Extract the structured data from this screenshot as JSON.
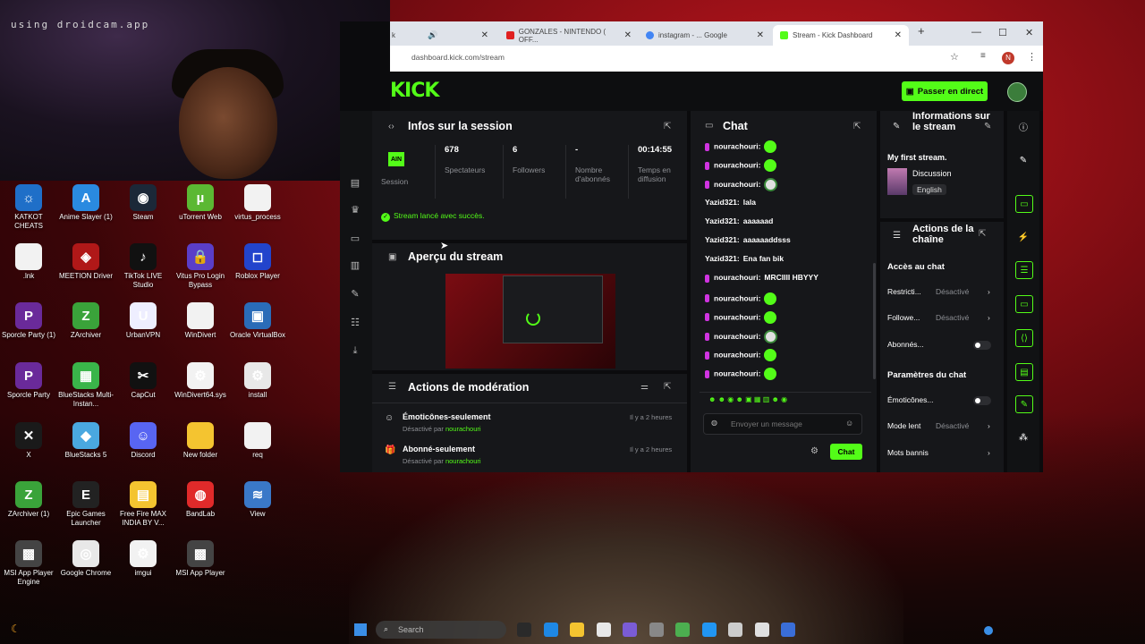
{
  "webcam": {
    "overlay_text": "using droidcam.app"
  },
  "desktop_icons": [
    {
      "label": "KATKOT CHEATS",
      "color": "#1f6fc8",
      "glyph": "☼"
    },
    {
      "label": "Anime Slayer (1)",
      "color": "#2a8ae0",
      "glyph": "A"
    },
    {
      "label": "Steam",
      "color": "#1b2838",
      "glyph": "◉"
    },
    {
      "label": "uTorrent Web",
      "color": "#5bb833",
      "glyph": "µ"
    },
    {
      "label": "virtus_process",
      "color": "#f2f2f2",
      "glyph": ""
    },
    {
      "label": ".lnk",
      "color": "#f2f2f2",
      "glyph": ""
    },
    {
      "label": "MEETION Driver",
      "color": "#b01818",
      "glyph": "◈"
    },
    {
      "label": "TikTok LIVE Studio",
      "color": "#111",
      "glyph": "♪"
    },
    {
      "label": "Vitus Pro Login Bypass",
      "color": "#5a3ec8",
      "glyph": "🔒"
    },
    {
      "label": "Roblox Player",
      "color": "#2244cc",
      "glyph": "◻"
    },
    {
      "label": "Sporcle Party (1)",
      "color": "#6a2a9a",
      "glyph": "P"
    },
    {
      "label": "ZArchiver",
      "color": "#3aa33a",
      "glyph": "Z"
    },
    {
      "label": "UrbanVPN",
      "color": "#eef",
      "glyph": "U"
    },
    {
      "label": "WinDivert",
      "color": "#f2f2f2",
      "glyph": ""
    },
    {
      "label": "Oracle VirtualBox",
      "color": "#2a6cb8",
      "glyph": "▣"
    },
    {
      "label": "Sporcle Party",
      "color": "#6a2a9a",
      "glyph": "P"
    },
    {
      "label": "BlueStacks Multi-Instan...",
      "color": "#3ab54a",
      "glyph": "▦"
    },
    {
      "label": "CapCut",
      "color": "#111",
      "glyph": "✂"
    },
    {
      "label": "WinDivert64.sys",
      "color": "#f2f2f2",
      "glyph": "⚙"
    },
    {
      "label": "install",
      "color": "#e8e8e8",
      "glyph": "⚙"
    },
    {
      "label": "X",
      "color": "#1a1a1a",
      "glyph": "✕"
    },
    {
      "label": "BlueStacks 5",
      "color": "#4aa8e0",
      "glyph": "◆"
    },
    {
      "label": "Discord",
      "color": "#5865f2",
      "glyph": "☺"
    },
    {
      "label": "New folder",
      "color": "#f4c430",
      "glyph": ""
    },
    {
      "label": "req",
      "color": "#f2f2f2",
      "glyph": ""
    },
    {
      "label": "ZArchiver (1)",
      "color": "#3aa33a",
      "glyph": "Z"
    },
    {
      "label": "Epic Games Launcher",
      "color": "#222",
      "glyph": "E"
    },
    {
      "label": "Free Fire MAX INDIA BY V...",
      "color": "#f4c430",
      "glyph": "▤"
    },
    {
      "label": "BandLab",
      "color": "#e02a2a",
      "glyph": "◍"
    },
    {
      "label": "View",
      "color": "#3a78c8",
      "glyph": "≋"
    },
    {
      "label": "MSI App Player Engine",
      "color": "#444",
      "glyph": "▩"
    },
    {
      "label": "Google Chrome",
      "color": "#e8e8e8",
      "glyph": "◎"
    },
    {
      "label": "imgui",
      "color": "#f2f2f2",
      "glyph": "⚙"
    },
    {
      "label": "MSI App Player",
      "color": "#444",
      "glyph": "▩"
    }
  ],
  "browser": {
    "tabs": [
      {
        "label": "k",
        "active": false
      },
      {
        "label": "GONZALES - NINTENDO ( OFF...",
        "active": false,
        "color": "#e02020"
      },
      {
        "label": "instagram - ...  Google",
        "active": false,
        "color": "#4285f4"
      },
      {
        "label": "Stream - Kick Dashboard",
        "active": true,
        "color": "#53fc18"
      }
    ],
    "new_tab": "+",
    "url": "dashboard.kick.com/stream",
    "profile_letter": "N"
  },
  "kick": {
    "logo": "KICK",
    "go_live": "Passer en direct",
    "session": {
      "title": "Infos sur la session",
      "live_badge": "AIN",
      "live_caption": "Session",
      "stats": [
        {
          "value": "678",
          "label": "Spectateurs"
        },
        {
          "value": "6",
          "label": "Followers"
        },
        {
          "value": "-",
          "label": "Nombre d'abonnés"
        },
        {
          "value": "00:14:55",
          "label": "Temps en diffusion"
        }
      ],
      "success": "Stream lancé avec succès."
    },
    "preview": {
      "title": "Aperçu du stream"
    },
    "moderation": {
      "title": "Actions de modération",
      "items": [
        {
          "title": "Émoticônes-seulement",
          "by_prefix": "Désactivé par",
          "by_user": "nourachouri",
          "time": "Il y a 2 heures"
        },
        {
          "title": "Abonné-seulement",
          "by_prefix": "Désactivé par",
          "by_user": "nourachouri",
          "time": "Il y a 2 heures"
        }
      ]
    },
    "chat": {
      "title": "Chat",
      "messages": [
        {
          "user": "nourachouri:",
          "text": "",
          "emote": "green",
          "badge": true
        },
        {
          "user": "nourachouri:",
          "text": "",
          "emote": "green",
          "badge": true
        },
        {
          "user": "nourachouri:",
          "text": "",
          "emote": "alt",
          "badge": true
        },
        {
          "user": "Yazid321:",
          "text": "lala",
          "badge": false
        },
        {
          "user": "Yazid321:",
          "text": "aaaaaad",
          "badge": false
        },
        {
          "user": "Yazid321:",
          "text": "aaaaaaddsss",
          "badge": false
        },
        {
          "user": "Yazid321:",
          "text": "Ena fan bik",
          "badge": false
        },
        {
          "user": "nourachouri:",
          "text": "MRCIIII HBYYY",
          "badge": true
        },
        {
          "user": "nourachouri:",
          "text": "",
          "emote": "green",
          "badge": true
        },
        {
          "user": "nourachouri:",
          "text": "",
          "emote": "green",
          "badge": true
        },
        {
          "user": "nourachouri:",
          "text": "",
          "emote": "alt",
          "badge": true
        },
        {
          "user": "nourachouri:",
          "text": "",
          "emote": "green",
          "badge": true
        },
        {
          "user": "nourachouri:",
          "text": "",
          "emote": "green",
          "badge": true
        }
      ],
      "input_placeholder": "Envoyer un message",
      "send_label": "Chat"
    },
    "info": {
      "title": "Informations sur le stream",
      "stream_title": "My first stream.",
      "category": "Discussion",
      "language": "English"
    },
    "channel_actions": {
      "title": "Actions de la chaîne",
      "access_title": "Accès au chat",
      "rows": [
        {
          "label": "Restricti...",
          "value": "Désactivé"
        },
        {
          "label": "Followe...",
          "value": "Désactivé"
        }
      ],
      "subs_label": "Abonnés...",
      "chat_params_title": "Paramètres du chat",
      "emotes_label": "Émoticônes...",
      "slow_label": "Mode lent",
      "slow_value": "Désactivé",
      "banned_label": "Mots bannis"
    }
  },
  "taskbar": {
    "search_placeholder": "Search"
  }
}
